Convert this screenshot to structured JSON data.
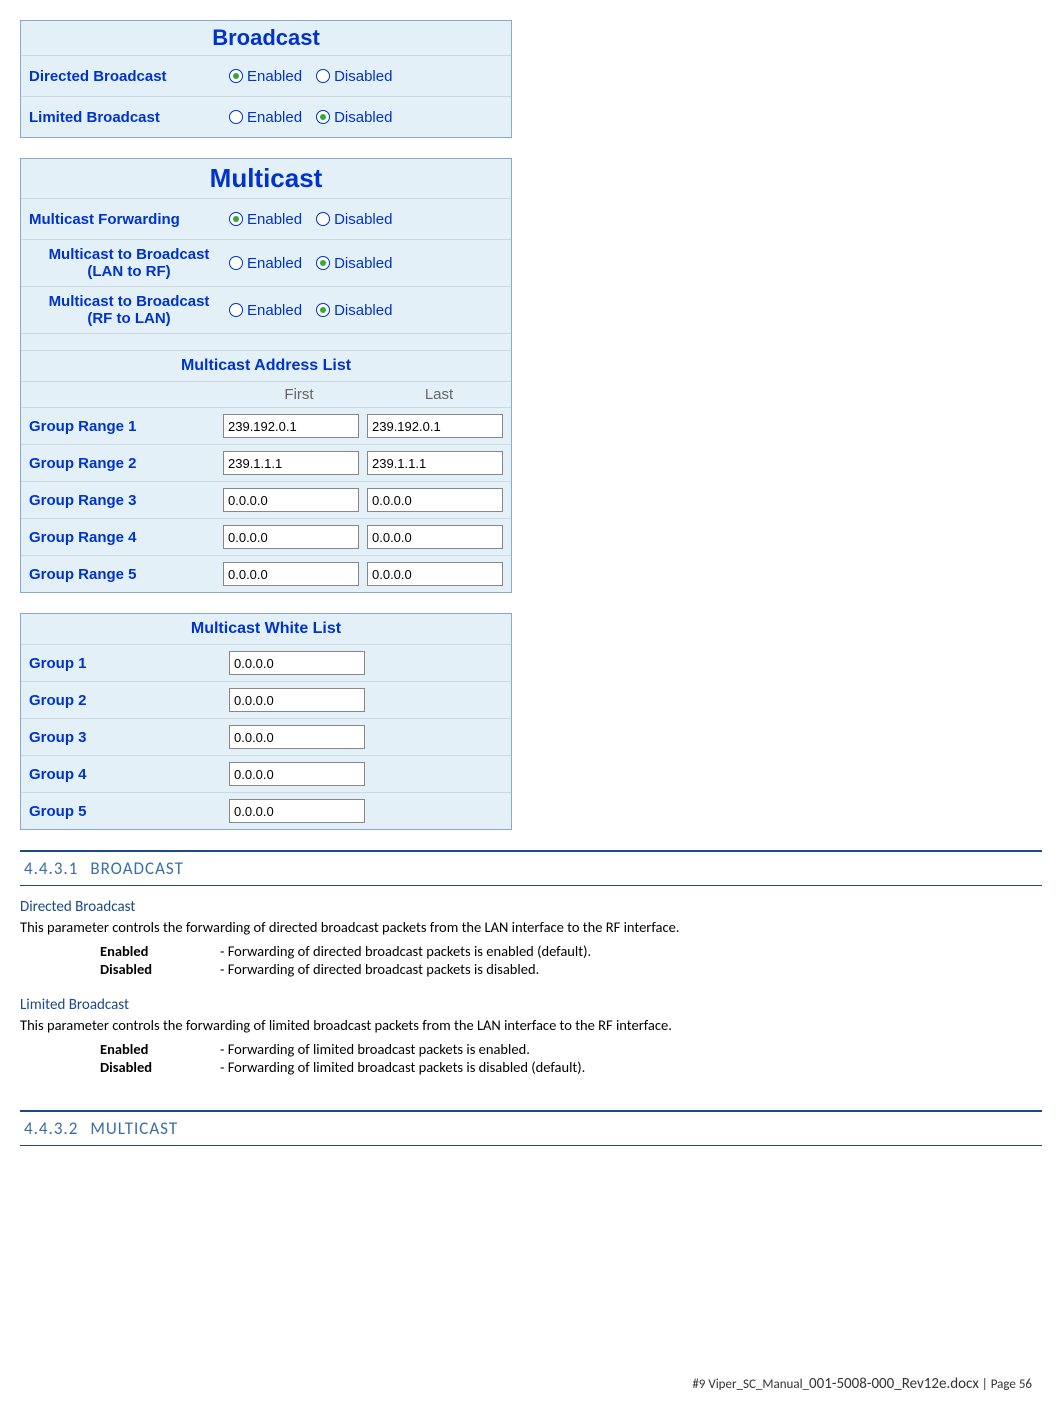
{
  "broadcast": {
    "title": "Broadcast",
    "rows": [
      {
        "label": "Directed Broadcast",
        "selected": 0
      },
      {
        "label": "Limited Broadcast",
        "selected": 1
      }
    ],
    "opt_enabled": "Enabled",
    "opt_disabled": "Disabled"
  },
  "multicast": {
    "title": "Multicast",
    "rows": [
      {
        "label": "Multicast Forwarding",
        "selected": 0
      },
      {
        "label": "Multicast to Broadcast\n(LAN to RF)",
        "selected": 1
      },
      {
        "label": "Multicast to Broadcast\n(RF to LAN)",
        "selected": 1
      }
    ],
    "opt_enabled": "Enabled",
    "opt_disabled": "Disabled",
    "addr_list_title": "Multicast Address List",
    "col_first": "First",
    "col_last": "Last",
    "ranges": [
      {
        "label": "Group Range 1",
        "first": "239.192.0.1",
        "last": "239.192.0.1"
      },
      {
        "label": "Group Range 2",
        "first": "239.1.1.1",
        "last": "239.1.1.1"
      },
      {
        "label": "Group Range 3",
        "first": "0.0.0.0",
        "last": "0.0.0.0"
      },
      {
        "label": "Group Range 4",
        "first": "0.0.0.0",
        "last": "0.0.0.0"
      },
      {
        "label": "Group Range 5",
        "first": "0.0.0.0",
        "last": "0.0.0.0"
      }
    ]
  },
  "whitelist": {
    "title": "Multicast White List",
    "rows": [
      {
        "label": "Group 1",
        "value": "0.0.0.0"
      },
      {
        "label": "Group 2",
        "value": "0.0.0.0"
      },
      {
        "label": "Group 3",
        "value": "0.0.0.0"
      },
      {
        "label": "Group 4",
        "value": "0.0.0.0"
      },
      {
        "label": "Group 5",
        "value": "0.0.0.0"
      }
    ]
  },
  "doc": {
    "sec1_num": "4.4.3.1",
    "sec1_title": "BROADCAST",
    "directed_title": "Directed Broadcast",
    "directed_desc": "This parameter controls the forwarding of directed broadcast packets from the LAN interface to the RF interface.",
    "directed_en_term": "Enabled",
    "directed_en_desc": "- Forwarding of directed broadcast packets is enabled (default).",
    "directed_dis_term": "Disabled",
    "directed_dis_desc": "- Forwarding of directed broadcast packets is disabled.",
    "limited_title": "Limited Broadcast",
    "limited_desc": "This parameter controls the forwarding of limited broadcast packets from the LAN interface to the RF interface.",
    "limited_en_term": "Enabled",
    "limited_en_desc": "- Forwarding of limited broadcast packets is enabled.",
    "limited_dis_term": "Disabled",
    "limited_dis_desc": "- Forwarding of limited broadcast packets is disabled (default).",
    "sec2_num": "4.4.3.2",
    "sec2_title": "MULTICAST"
  },
  "footer": {
    "prefix": "#9 Viper_SC_Manual_",
    "doc": "001-5008-000_Rev12e.docx",
    "sep": " | ",
    "page": "Page 56"
  }
}
